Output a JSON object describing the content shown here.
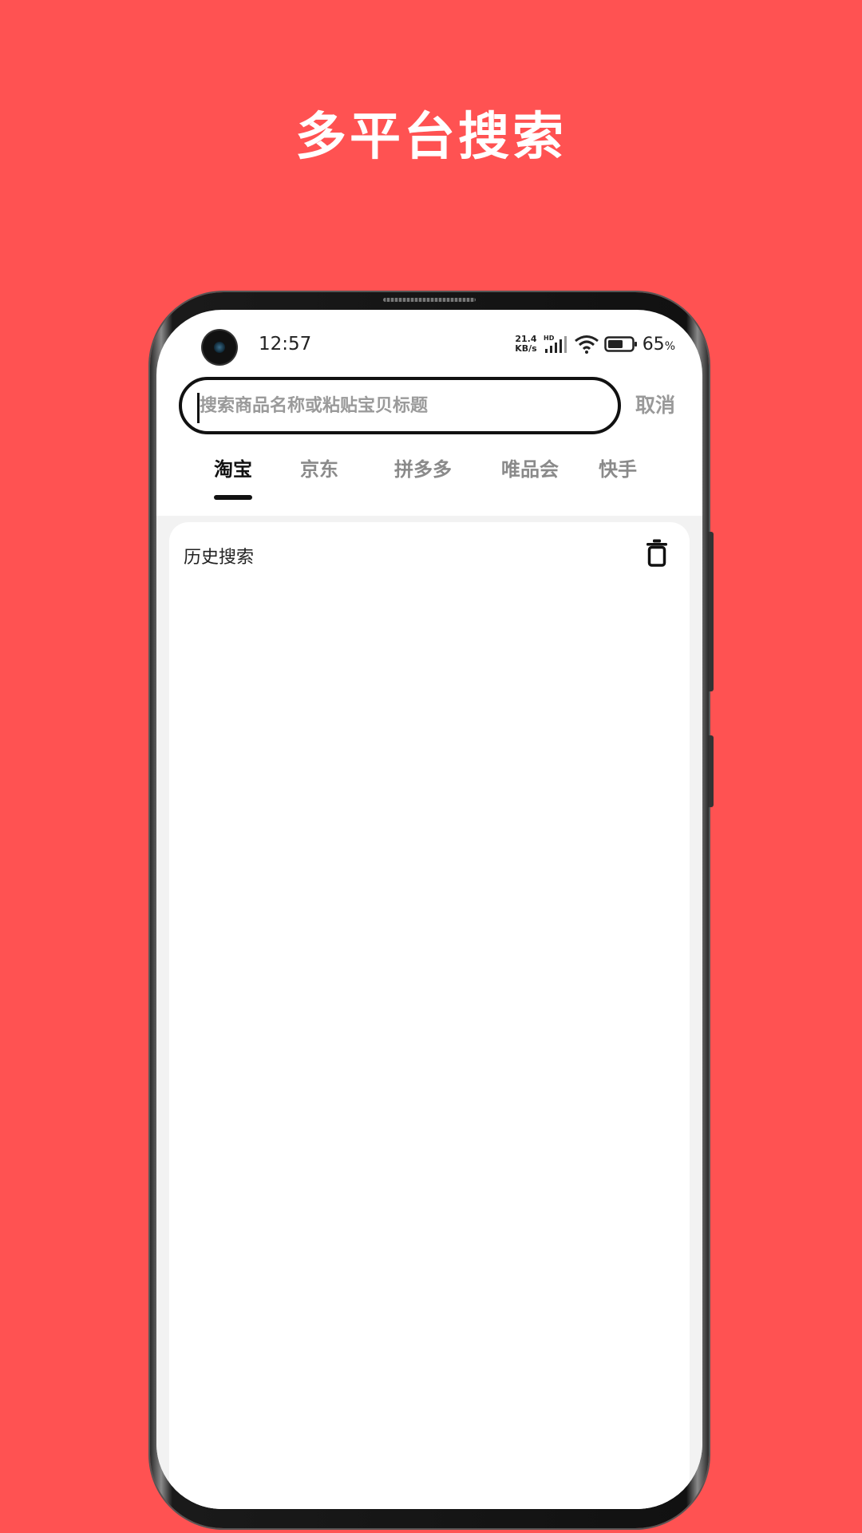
{
  "headline": "多平台搜索",
  "status_bar": {
    "time": "12:57",
    "net_speed_value": "21.4",
    "net_speed_unit": "KB/s",
    "signal_label": "HD",
    "battery_value": "65",
    "battery_unit": "%"
  },
  "search": {
    "placeholder": "搜索商品名称或粘贴宝贝标题",
    "value": "",
    "cancel_label": "取消"
  },
  "tabs": [
    {
      "label": "淘宝",
      "active": true
    },
    {
      "label": "京东",
      "active": false
    },
    {
      "label": "拼多多",
      "active": false
    },
    {
      "label": "唯品会",
      "active": false
    },
    {
      "label": "快手",
      "active": false
    }
  ],
  "history": {
    "title": "历史搜索",
    "items": []
  },
  "colors": {
    "background": "#FF5252",
    "accent": "#111111",
    "inactive_tab": "#8a8a8a"
  },
  "icons": {
    "delete": "trash-icon",
    "wifi": "wifi-icon",
    "signal": "signal-icon",
    "battery": "battery-icon"
  }
}
